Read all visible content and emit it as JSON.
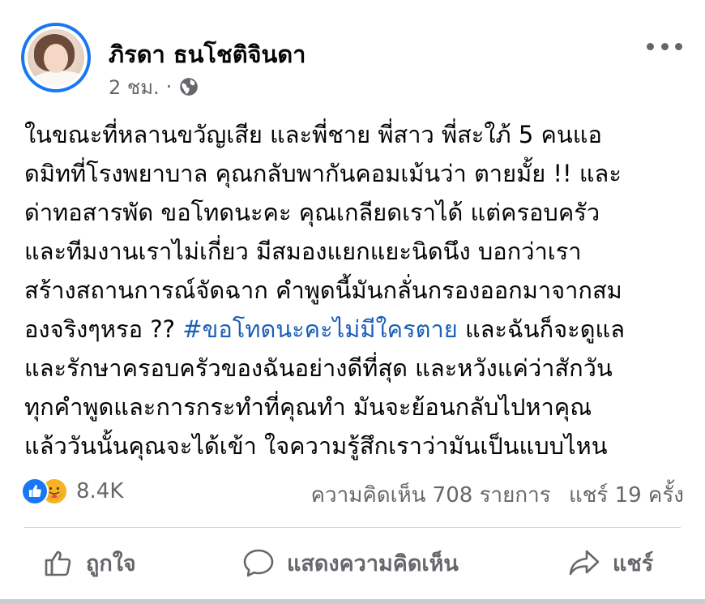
{
  "post": {
    "author": "ภิรดา ธนโชติจินดา",
    "time": "2 ชม.",
    "separator": "·",
    "privacy_icon": "globe-icon",
    "more_icon": "more-horizontal-icon",
    "lines": [
      "ในขณะที่หลานขวัญเสีย และพี่ชาย พี่สาว พี่สะใภ้ 5 คนแอ",
      "ดมิทที่โรงพยาบาล คุณกลับพากันคอมเม้นว่า ตายมั้ย !! และ",
      "ด่าทอสารพัด ขอโทดนะคะ คุณเกลียดเราได้ แต่ครอบครัว",
      "และทีมงานเราไม่เกี่ยว มีสมองแยกแยะนิดนึง  บอกว่าเรา",
      "สร้างสถานการณ์จัดฉาก คำพูดนี้มันกลั่นกรองออกมาจากสม"
    ],
    "line6_before": "องจริงๆหรอ ??  ",
    "hashtag": "#ขอโทดนะคะไม่มีใครตาย",
    "line6_after": " และฉันก็จะดูแล",
    "lines_end": [
      "และรักษาครอบครัวของฉันอย่างดีที่สุด   และหวังแค่ว่าสักวัน",
      "ทุกคำพูดและการกระทำที่คุณทำ มันจะย้อนกลับไปหาคุณ",
      "แล้ววันนั้นคุณจะได้เข้า ใจความรู้สึกเราว่ามันเป็นแบบไหน"
    ]
  },
  "stats": {
    "reaction_count": "8.4K",
    "comments": "ความคิดเห็น 708 รายการ",
    "shares": "แชร์ 19 ครั้ง"
  },
  "actions": {
    "like": "ถูกใจ",
    "comment": "แสดงความคิดเห็น",
    "share": "แชร์"
  },
  "colors": {
    "accent": "#1877f2",
    "hashtag": "#1b5fb8",
    "secondary_text": "#65676b"
  }
}
